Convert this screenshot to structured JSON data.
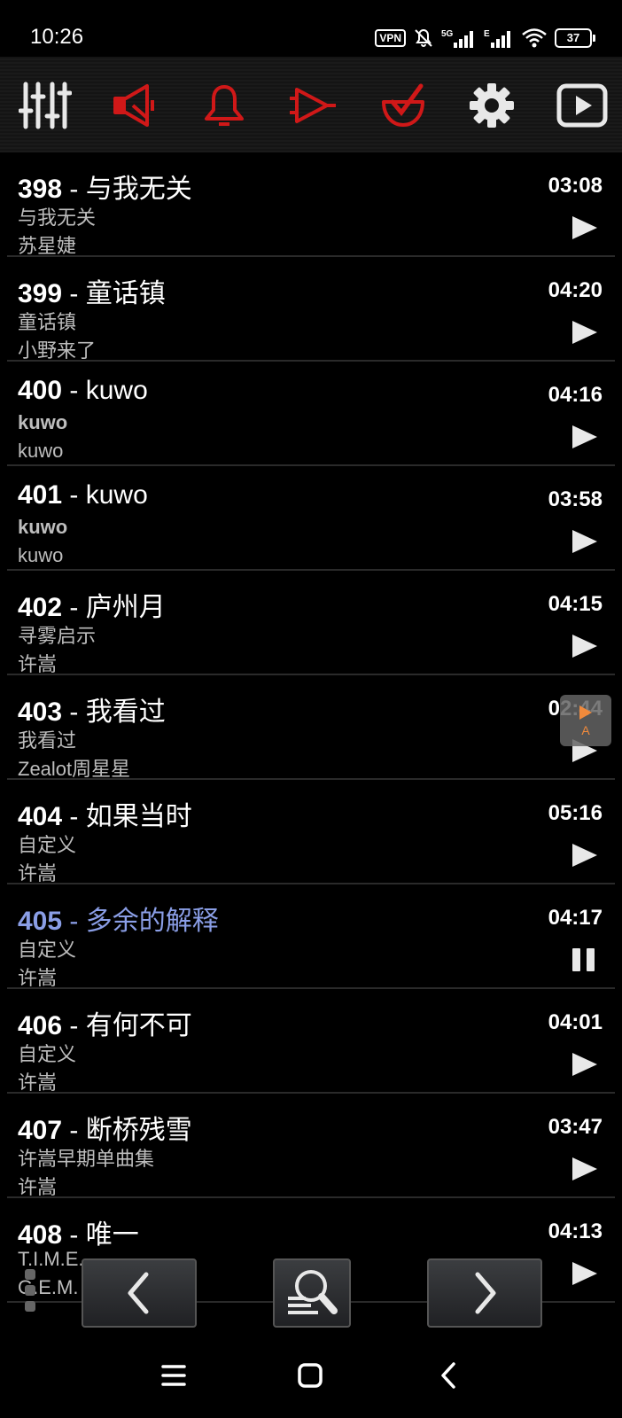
{
  "status": {
    "time": "10:26",
    "vpn": "VPN",
    "battery": "37",
    "icons": [
      "mute-icon",
      "5g-signal-icon",
      "e-signal-icon",
      "wifi-icon"
    ]
  },
  "toolbar": {
    "icons": [
      "equalizer-icon",
      "speaker-icon",
      "bell-icon",
      "forward-icon",
      "check-bowl-icon",
      "gear-icon",
      "play-screen-icon"
    ],
    "colors": {
      "red": "#d01818",
      "white": "#e8e8e8"
    }
  },
  "tracks": [
    {
      "number": "398",
      "title": "与我无关",
      "album": "与我无关",
      "artist": "苏星婕",
      "duration": "03:08",
      "state": "play"
    },
    {
      "number": "399",
      "title": "童话镇",
      "album": "童话镇",
      "artist": "小野来了",
      "duration": "04:20",
      "state": "play"
    },
    {
      "number": "400",
      "title": "kuwo",
      "album": "kuwo",
      "artist": "kuwo",
      "duration": "04:16",
      "state": "play"
    },
    {
      "number": "401",
      "title": "kuwo",
      "album": "kuwo",
      "artist": "kuwo",
      "duration": "03:58",
      "state": "play"
    },
    {
      "number": "402",
      "title": "庐州月",
      "album": "寻雾启示",
      "artist": "许嵩",
      "duration": "04:15",
      "state": "play"
    },
    {
      "number": "403",
      "title": "我看过",
      "album": "我看过",
      "artist": "Zealot周星星",
      "duration": "02:44",
      "state": "play"
    },
    {
      "number": "404",
      "title": "如果当时",
      "album": "自定义",
      "artist": "许嵩",
      "duration": "05:16",
      "state": "play"
    },
    {
      "number": "405",
      "title": "多余的解释",
      "album": "自定义",
      "artist": "许嵩",
      "duration": "04:17",
      "state": "pause"
    },
    {
      "number": "406",
      "title": "有何不可",
      "album": "自定义",
      "artist": "许嵩",
      "duration": "04:01",
      "state": "play"
    },
    {
      "number": "407",
      "title": "断桥残雪",
      "album": "许嵩早期单曲集",
      "artist": "许嵩",
      "duration": "03:47",
      "state": "play"
    },
    {
      "number": "408",
      "title": "唯一",
      "album": "T.I.M.E.",
      "artist": "G.E.M.",
      "duration": "04:13",
      "state": "play"
    }
  ],
  "active_color": "#8a9ee6",
  "bubble": {
    "label": "A"
  },
  "nav": {
    "prev": "chevron-left-icon",
    "search": "search-list-icon",
    "next": "chevron-right-icon"
  },
  "system_bar": [
    "menu-icon",
    "home-icon",
    "back-icon"
  ]
}
